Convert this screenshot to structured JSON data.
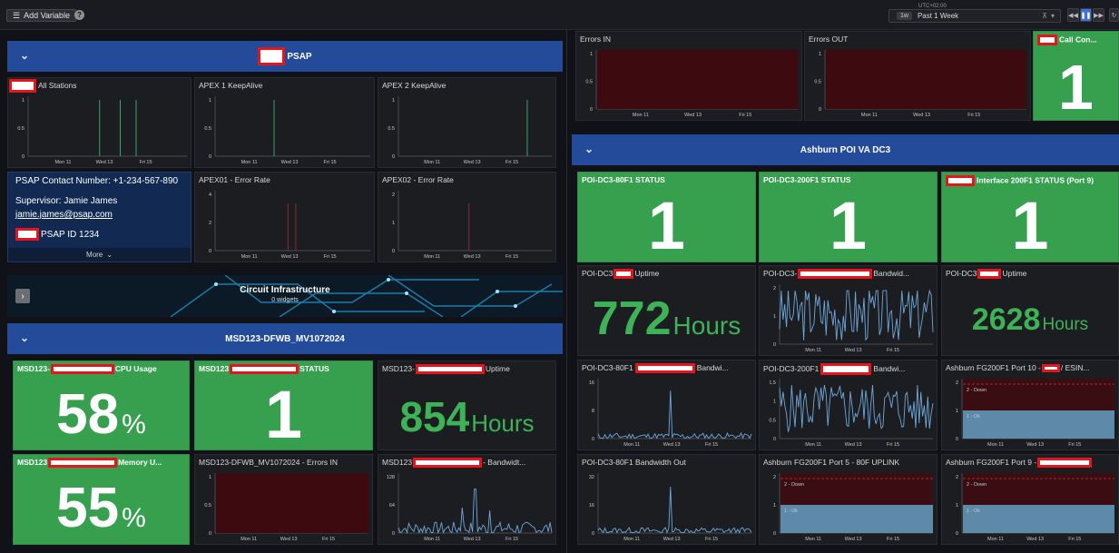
{
  "toolbar": {
    "add_variable": "Add Variable",
    "help": "?",
    "time_badge": "1w",
    "time_range": "Past 1 Week",
    "timezone": "UTC+02:00"
  },
  "x_ticks": [
    "Mon 11",
    "Wed 13",
    "Fri 15"
  ],
  "sections": {
    "psap": "PSAP",
    "circuit_title": "Circuit Infrastructure",
    "circuit_sub": "0 widgets",
    "msd": "MSD123-DFWB_MV1072024",
    "ashburn": "Ashburn POI VA DC3"
  },
  "psap_panels": {
    "all_stations": "All Stations",
    "apex1_keepalive": "APEX 1 KeepAlive",
    "apex2_keepalive": "APEX 2 KeepAlive",
    "apex01_error": "APEX01 - Error Rate",
    "apex02_error": "APEX02 - Error Rate",
    "yticks_01": [
      "1",
      "0.5",
      "0"
    ],
    "yticks_apex01": [
      "4",
      "2",
      "0"
    ],
    "yticks_apex02": [
      "2",
      "1",
      "0"
    ]
  },
  "psap_info": {
    "contact": "PSAP Contact Number: +1-234-567-890",
    "supervisor": "Supervisor: Jamie James",
    "email": "jamie.james@psap.com",
    "psap_id": "PSAP ID 1234",
    "more": "More"
  },
  "msd_panels": {
    "cpu_title_a": "MSD123-",
    "cpu_title_b": "CPU Usage",
    "cpu_value": "58",
    "cpu_unit": "%",
    "status_title": "MSD123",
    "status_title_b": "STATUS",
    "status_value": "1",
    "uptime_title": "MSD123-",
    "uptime_title_b": "Uptime",
    "uptime_value": "854",
    "uptime_unit": "Hours",
    "mem_title_a": "MSD123",
    "mem_title_b": "Memory U...",
    "mem_value": "55",
    "mem_unit": "%",
    "errors_in_title": "MSD123-DFWB_MV1072024 - Errors IN",
    "errors_in_yticks": [
      "1",
      "0.5",
      "0"
    ],
    "bw_title_a": "MSD123",
    "bw_title_b": "- Bandwidt...",
    "bw_yticks": [
      "128",
      "64",
      "0"
    ]
  },
  "top_right": {
    "errors_in": "Errors IN",
    "errors_out": "Errors OUT",
    "call_con": "Call Con...",
    "call_con_value": "1",
    "yticks": [
      "1",
      "0.5",
      "0"
    ]
  },
  "ashburn_panels": {
    "s80_title": "POI-DC3-80F1 STATUS",
    "s80_value": "1",
    "s200_title": "POI-DC3-200F1 STATUS",
    "s200_value": "1",
    "iface_title": "Interface 200F1 STATUS (Port 9)",
    "iface_value": "1",
    "up1_title_a": "POI-DC3",
    "up1_title_b": "Uptime",
    "up1_value": "772",
    "up1_unit": "Hours",
    "bw1_title_a": "POI-DC3-",
    "bw1_title_b": "Bandwid...",
    "bw1_yticks": [
      "2",
      "1",
      "0"
    ],
    "up2_title_a": "POI-DC3",
    "up2_title_b": "Uptime",
    "up2_value": "2628",
    "up2_unit": "Hours",
    "bw80_title_a": "POI-DC3-80F1",
    "bw80_title_b": "Bandwi...",
    "bw80_yticks": [
      "16",
      "8",
      "0"
    ],
    "bw200_title_a": "POI-DC3-200F1",
    "bw200_title_b": "Bandwi...",
    "bw200_yticks": [
      "1.5",
      "1",
      "0.5",
      "0"
    ],
    "fg10_title_a": "Ashburn FG200F1 Port 10 -",
    "fg10_title_b": "/ ESIN...",
    "state_yticks": [
      "2",
      "1",
      "0"
    ],
    "down_label": "2 - Down",
    "ok_label": "1 - Ok",
    "bwout_title": "POI-DC3-80F1 Bandwidth Out",
    "bwout_yticks": [
      "32",
      "16",
      "0"
    ],
    "fg5_title": "Ashburn FG200F1 Port 5 - 80F UPLINK",
    "fg9_title_a": "Ashburn FG200F1 Port 9 -"
  },
  "colors": {
    "green": "#37a04f",
    "header_blue": "#244b99",
    "series_blue": "#6fa8dc",
    "error_fill": "#3d0b0f"
  }
}
